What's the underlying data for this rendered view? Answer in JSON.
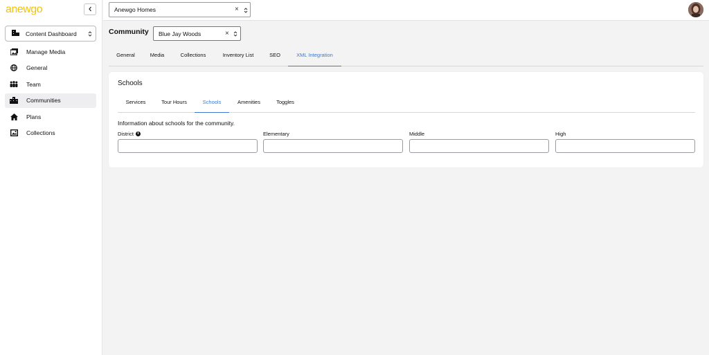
{
  "brand": {
    "logo_text": "anewgo",
    "accent": "#f5c400"
  },
  "sidebar": {
    "dashboard_select": "Content Dashboard",
    "items": [
      {
        "label": "Manage Media",
        "icon": "media-icon"
      },
      {
        "label": "General",
        "icon": "globe-icon"
      },
      {
        "label": "Team",
        "icon": "team-icon"
      },
      {
        "label": "Communities",
        "icon": "buildings-icon",
        "active": true
      },
      {
        "label": "Plans",
        "icon": "home-icon"
      },
      {
        "label": "Collections",
        "icon": "collections-icon"
      }
    ]
  },
  "topbar": {
    "builder_select": "Anewgo Homes"
  },
  "main": {
    "community_label": "Community",
    "community_select": "Blue Jay Woods",
    "tabs": [
      "General",
      "Media",
      "Collections",
      "Inventory List",
      "SEO",
      "XML Integration"
    ],
    "active_tab": "XML Integration",
    "card": {
      "title": "Schools",
      "subtabs": [
        "Services",
        "Tour Hours",
        "Schools",
        "Amenities",
        "Toggles"
      ],
      "active_subtab": "Schools",
      "info": "Information about schools for the community.",
      "fields": [
        {
          "label": "District",
          "value": ""
        },
        {
          "label": "Elementary",
          "value": ""
        },
        {
          "label": "Middle",
          "value": ""
        },
        {
          "label": "High",
          "value": ""
        }
      ]
    }
  },
  "colors": {
    "active_tab": "#3f78d1",
    "background": "#f3f3f4"
  }
}
